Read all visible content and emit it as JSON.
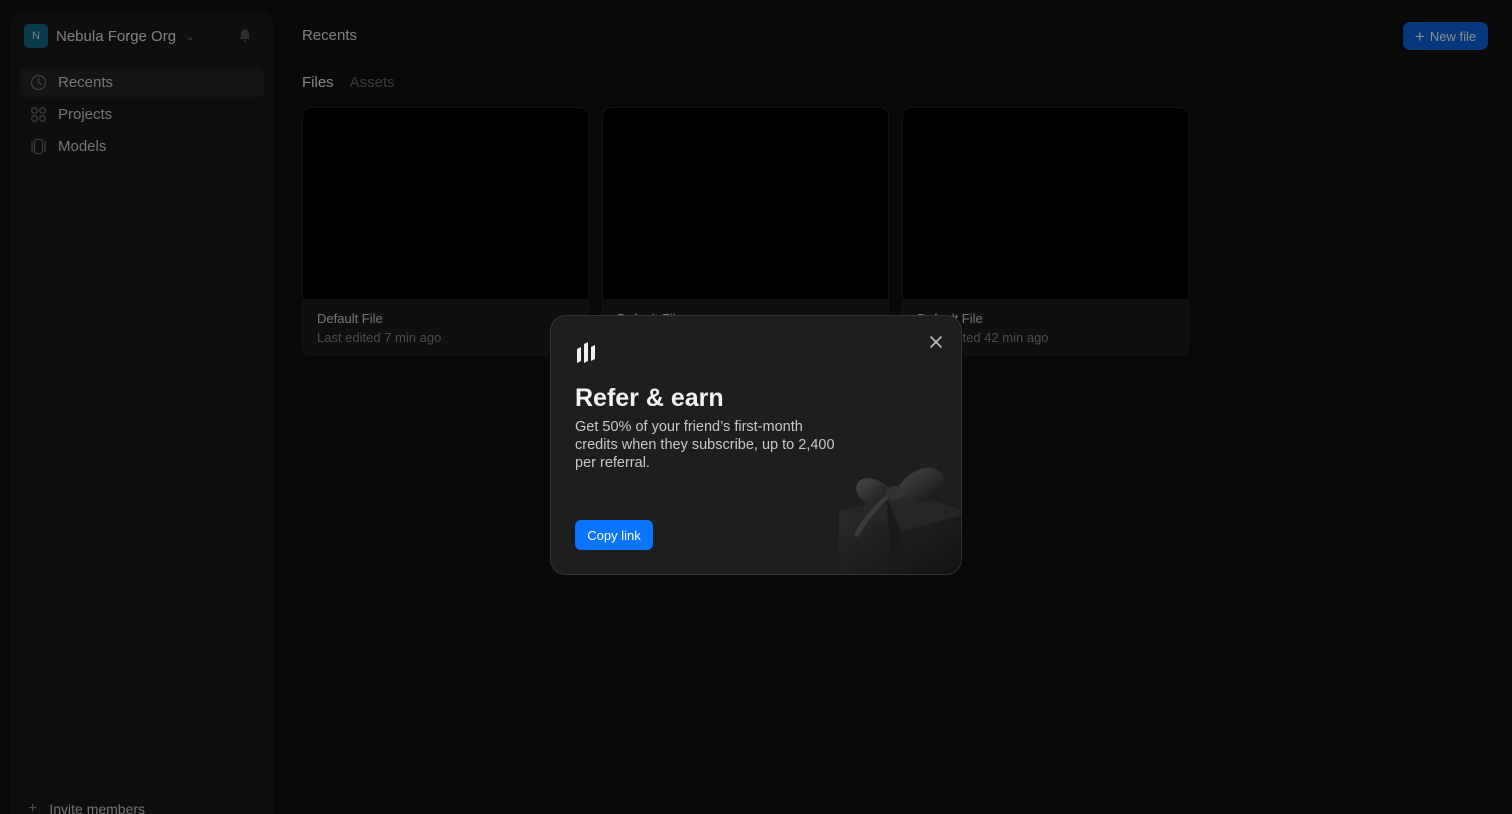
{
  "sidebar": {
    "org": {
      "initial": "N",
      "name": "Nebula Forge Org"
    },
    "items": [
      {
        "label": "Recents",
        "icon": "clock-icon",
        "active": true
      },
      {
        "label": "Projects",
        "icon": "grid-icon",
        "active": false
      },
      {
        "label": "Models",
        "icon": "cube-icon",
        "active": false
      }
    ],
    "invite_label": "Invite members"
  },
  "header": {
    "title": "Recents",
    "new_file_label": "New file"
  },
  "tabs": [
    {
      "label": "Files",
      "active": true
    },
    {
      "label": "Assets",
      "active": false
    }
  ],
  "files": [
    {
      "title": "Default File",
      "meta": "Last edited 7 min ago"
    },
    {
      "title": "Default File",
      "meta": ""
    },
    {
      "title": "Default File",
      "meta": "Last edited 42 min ago"
    }
  ],
  "modal": {
    "title": "Refer & earn",
    "text": "Get 50% of your friend’s first-month credits when they subscribe, up to 2,400 per referral.",
    "copy_label": "Copy link"
  },
  "colors": {
    "accent": "#0a74ff",
    "org_avatar": "#0f6a86"
  }
}
